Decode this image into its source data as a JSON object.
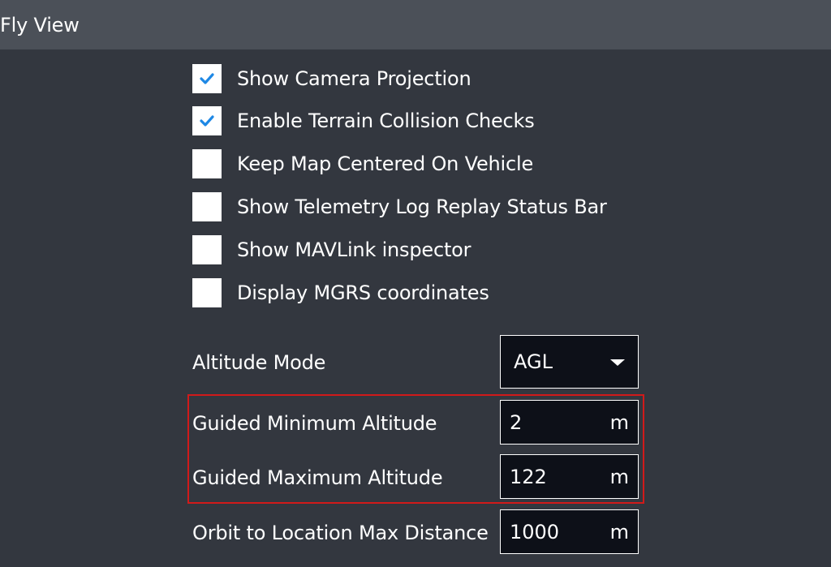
{
  "header": {
    "title": "Fly View"
  },
  "checkboxes": [
    {
      "label": "Show Camera Projection",
      "checked": true
    },
    {
      "label": "Enable Terrain Collision Checks",
      "checked": true
    },
    {
      "label": "Keep Map Centered On Vehicle",
      "checked": false
    },
    {
      "label": "Show Telemetry Log Replay Status Bar",
      "checked": false
    },
    {
      "label": "Show MAVLink inspector",
      "checked": false
    },
    {
      "label": "Display MGRS coordinates",
      "checked": false
    }
  ],
  "altitude_mode": {
    "label": "Altitude Mode",
    "value": "AGL"
  },
  "guided_min_altitude": {
    "label": "Guided Minimum Altitude",
    "value": "2",
    "unit": "m"
  },
  "guided_max_altitude": {
    "label": "Guided Maximum Altitude",
    "value": "122",
    "unit": "m"
  },
  "orbit_max_distance": {
    "label": "Orbit to Location Max Distance",
    "value": "1000",
    "unit": "m"
  },
  "colors": {
    "background": "#33373f",
    "header": "#4b5058",
    "check": "#1e88e5",
    "field_bg": "#0d1018",
    "highlight": "#d11a1a"
  }
}
